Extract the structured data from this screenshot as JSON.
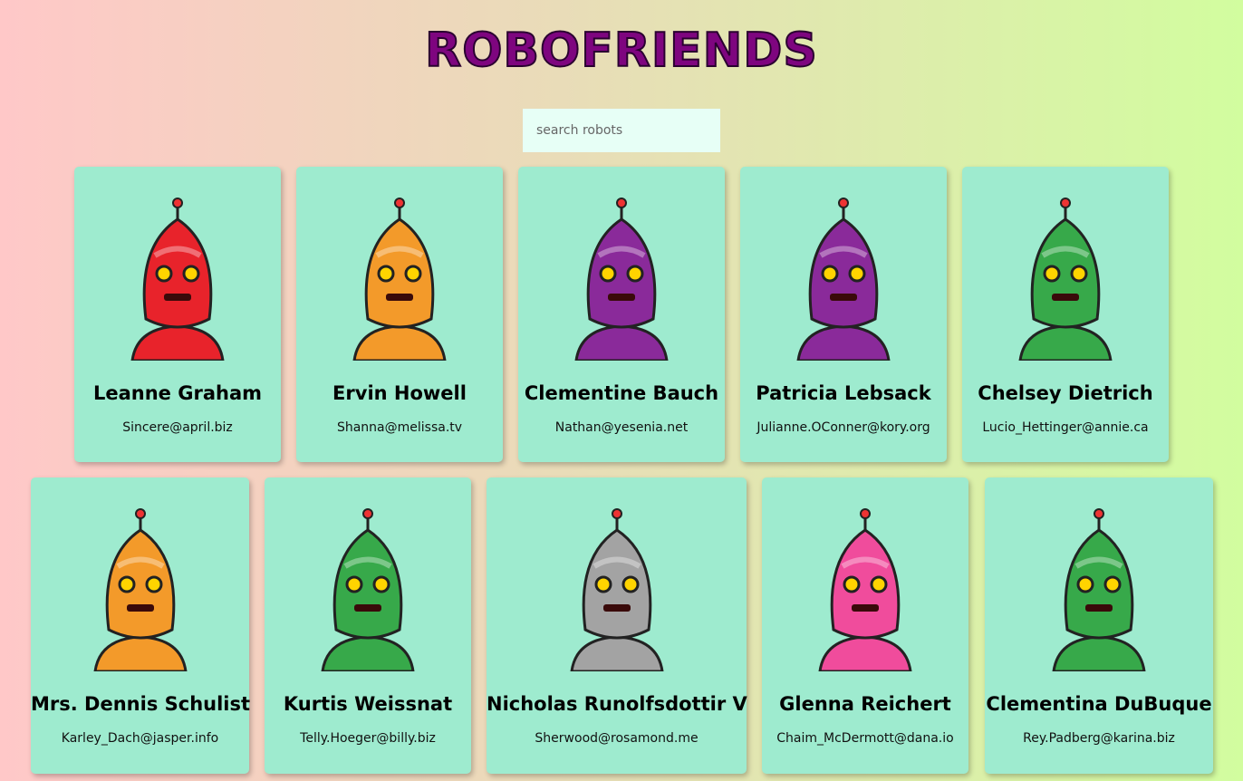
{
  "app": {
    "title": "ROBOFRIENDS"
  },
  "search": {
    "placeholder": "search robots",
    "value": ""
  },
  "robots": [
    {
      "name": "Leanne Graham",
      "email": "Sincere@april.biz",
      "color": "#e8232b"
    },
    {
      "name": "Ervin Howell",
      "email": "Shanna@melissa.tv",
      "color": "#f39a2a"
    },
    {
      "name": "Clementine Bauch",
      "email": "Nathan@yesenia.net",
      "color": "#8a2a9a"
    },
    {
      "name": "Patricia Lebsack",
      "email": "Julianne.OConner@kory.org",
      "color": "#8a2a9a"
    },
    {
      "name": "Chelsey Dietrich",
      "email": "Lucio_Hettinger@annie.ca",
      "color": "#37a94a"
    },
    {
      "name": "Mrs. Dennis Schulist",
      "email": "Karley_Dach@jasper.info",
      "color": "#f39a2a"
    },
    {
      "name": "Kurtis Weissnat",
      "email": "Telly.Hoeger@billy.biz",
      "color": "#37a94a"
    },
    {
      "name": "Nicholas Runolfsdottir V",
      "email": "Sherwood@rosamond.me",
      "color": "#a3a3a3"
    },
    {
      "name": "Glenna Reichert",
      "email": "Chaim_McDermott@dana.io",
      "color": "#f04c9c"
    },
    {
      "name": "Clementina DuBuque",
      "email": "Rey.Padberg@karina.biz",
      "color": "#37a94a"
    }
  ]
}
